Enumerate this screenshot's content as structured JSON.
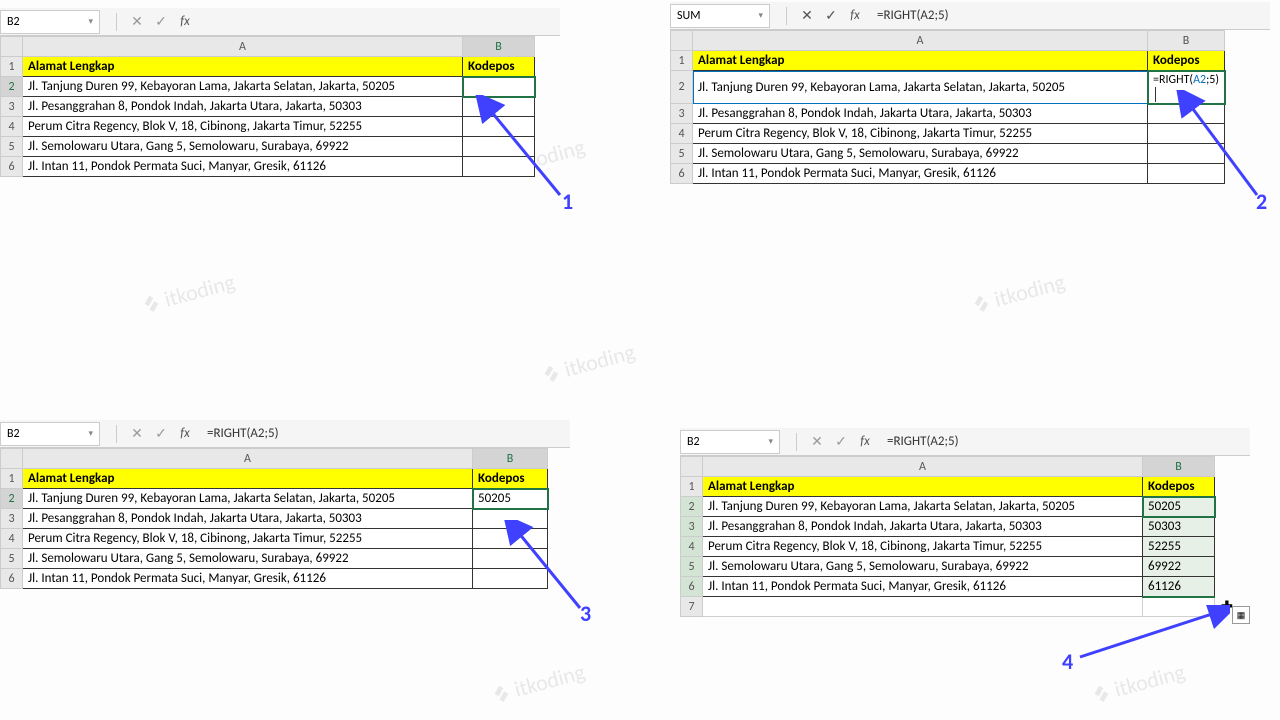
{
  "panels": {
    "p1": {
      "name_box": "B2",
      "formula": "",
      "col_a_width": 440,
      "col_b_width": 72,
      "headerA": "Alamat Lengkap",
      "headerB": "Kodepos",
      "selected_row": 2,
      "rows": [
        {
          "a": "Jl. Tanjung Duren 99, Kebayoran Lama, Jakarta Selatan, Jakarta, 50205",
          "b": ""
        },
        {
          "a": "Jl. Pesanggrahan 8, Pondok Indah, Jakarta Utara, Jakarta, 50303",
          "b": ""
        },
        {
          "a": "Perum Citra Regency, Blok V, 18, Cibinong, Jakarta Timur, 52255",
          "b": ""
        },
        {
          "a": "Jl. Semolowaru Utara, Gang 5, Semolowaru, Surabaya, 69922",
          "b": ""
        },
        {
          "a": "Jl. Intan 11, Pondok Permata Suci, Manyar, Gresik, 61126",
          "b": ""
        }
      ],
      "arrow_label": "1"
    },
    "p2": {
      "name_box": "SUM",
      "formula": "=RIGHT(A2;5)",
      "col_a_width": 455,
      "col_b_width": 72,
      "headerA": "Alamat Lengkap",
      "headerB": "Kodepos",
      "selected_row": 2,
      "editing_value": "=RIGHT(A2;5)",
      "rows": [
        {
          "a": "Jl. Tanjung Duren 99, Kebayoran Lama, Jakarta Selatan, Jakarta, 50205",
          "b": "=RIGHT(A2;5)"
        },
        {
          "a": "Jl. Pesanggrahan 8, Pondok Indah, Jakarta Utara, Jakarta, 50303",
          "b": ""
        },
        {
          "a": "Perum Citra Regency, Blok V, 18, Cibinong, Jakarta Timur, 52255",
          "b": ""
        },
        {
          "a": "Jl. Semolowaru Utara, Gang 5, Semolowaru, Surabaya, 69922",
          "b": ""
        },
        {
          "a": "Jl. Intan 11, Pondok Permata Suci, Manyar, Gresik, 61126",
          "b": ""
        }
      ],
      "arrow_label": "2"
    },
    "p3": {
      "name_box": "B2",
      "formula": "=RIGHT(A2;5)",
      "col_a_width": 450,
      "col_b_width": 75,
      "headerA": "Alamat Lengkap",
      "headerB": "Kodepos",
      "selected_row": 2,
      "rows": [
        {
          "a": "Jl. Tanjung Duren 99, Kebayoran Lama, Jakarta Selatan, Jakarta, 50205",
          "b": "50205"
        },
        {
          "a": "Jl. Pesanggrahan 8, Pondok Indah, Jakarta Utara, Jakarta, 50303",
          "b": ""
        },
        {
          "a": "Perum Citra Regency, Blok V, 18, Cibinong, Jakarta Timur, 52255",
          "b": ""
        },
        {
          "a": "Jl. Semolowaru Utara, Gang 5, Semolowaru, Surabaya, 69922",
          "b": ""
        },
        {
          "a": "Jl. Intan 11, Pondok Permata Suci, Manyar, Gresik, 61126",
          "b": ""
        }
      ],
      "arrow_label": "3"
    },
    "p4": {
      "name_box": "B2",
      "formula": "=RIGHT(A2;5)",
      "col_a_width": 440,
      "col_b_width": 72,
      "headerA": "Alamat Lengkap",
      "headerB": "Kodepos",
      "fill_selected": true,
      "extra_row": true,
      "rows": [
        {
          "a": "Jl. Tanjung Duren 99, Kebayoran Lama, Jakarta Selatan, Jakarta, 50205",
          "b": "50205"
        },
        {
          "a": "Jl. Pesanggrahan 8, Pondok Indah, Jakarta Utara, Jakarta, 50303",
          "b": "50303"
        },
        {
          "a": "Perum Citra Regency, Blok V, 18, Cibinong, Jakarta Timur, 52255",
          "b": "52255"
        },
        {
          "a": "Jl. Semolowaru Utara, Gang 5, Semolowaru, Surabaya, 69922",
          "b": "69922"
        },
        {
          "a": "Jl. Intan 11, Pondok Permata Suci, Manyar, Gresik, 61126",
          "b": "61126"
        }
      ],
      "arrow_label": "4"
    }
  },
  "icons": {
    "cancel": "✕",
    "accept": "✓",
    "fx": "fx",
    "dropdown": "▾"
  }
}
